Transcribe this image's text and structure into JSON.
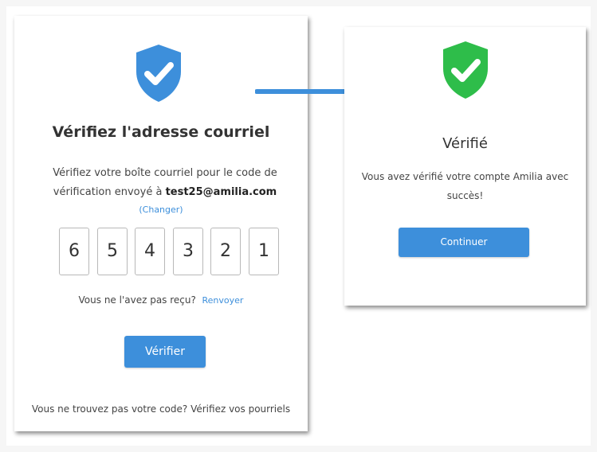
{
  "colors": {
    "accent": "#3d8fdb",
    "shield_blue": "#3d8fdb",
    "shield_green": "#2ebd4a"
  },
  "left_card": {
    "icon": "shield-check-icon",
    "title": "Vérifiez l'adresse courriel",
    "description": "Vérifiez votre boîte courriel pour le code de vérification envoyé à",
    "email": "test25@amilia.com",
    "change_link": "(Changer)",
    "code_digits": [
      "6",
      "5",
      "4",
      "3",
      "2",
      "1"
    ],
    "not_received_text": "Vous ne l'avez pas reçu?",
    "resend_link": "Renvoyer",
    "verify_button": "Vérifier",
    "footer_text": "Vous ne trouvez pas votre code? Vérifiez vos pourriels"
  },
  "arrow": {
    "icon": "arrow-right-icon"
  },
  "right_card": {
    "icon": "shield-check-icon",
    "title": "Vérifié",
    "message": "Vous avez vérifié votre compte Amilia avec succès!",
    "continue_button": "Continuer"
  }
}
